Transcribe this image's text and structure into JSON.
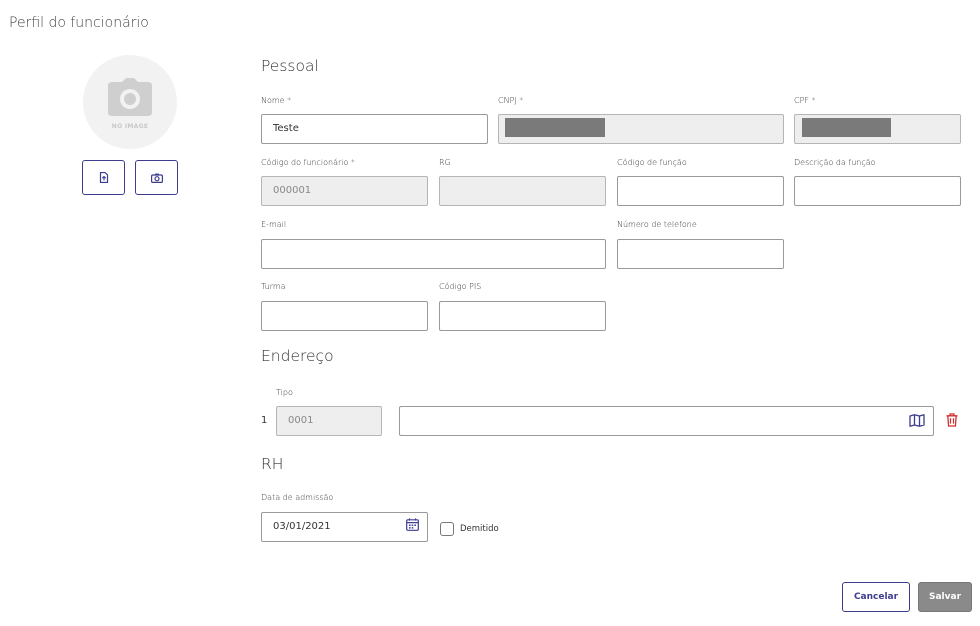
{
  "page_title": "Perfil do funcionário",
  "avatar": {
    "no_image_text": "NO IMAGE"
  },
  "sections": {
    "personal": "Pessoal",
    "address": "Endereço",
    "hr": "RH"
  },
  "fields": {
    "name": {
      "label": "Nome *",
      "value": "Teste"
    },
    "cnpj": {
      "label": "CNPJ *"
    },
    "cpf": {
      "label": "CPF *"
    },
    "employee_code": {
      "label": "Código do funcionário *",
      "value": "000001"
    },
    "rg": {
      "label": "RG",
      "value": ""
    },
    "function_code": {
      "label": "Código de função",
      "value": ""
    },
    "function_description": {
      "label": "Descrição da função",
      "value": ""
    },
    "email": {
      "label": "E-mail",
      "value": ""
    },
    "phone": {
      "label": "Número de telefone",
      "value": ""
    },
    "class": {
      "label": "Turma",
      "value": ""
    },
    "pis_code": {
      "label": "Código PIS",
      "value": ""
    }
  },
  "address": {
    "type_label": "Tipo",
    "rows": [
      {
        "index": "1",
        "type_value": "0001",
        "address_value": ""
      }
    ]
  },
  "hr": {
    "admission_label": "Data de admissão",
    "admission_date": "03/01/2021",
    "dismissed_label": "Demitido",
    "dismissed_checked": false
  },
  "buttons": {
    "cancel": "Cancelar",
    "save": "Salvar"
  },
  "colors": {
    "accent": "#3e3c8f",
    "delete": "#d32f2f",
    "disabled_bg": "#eeeeee",
    "save_bg": "#8a8a8a"
  },
  "icons": [
    "camera-icon",
    "upload-file-icon",
    "capture-photo-icon",
    "map-icon",
    "trash-icon",
    "calendar-icon"
  ]
}
